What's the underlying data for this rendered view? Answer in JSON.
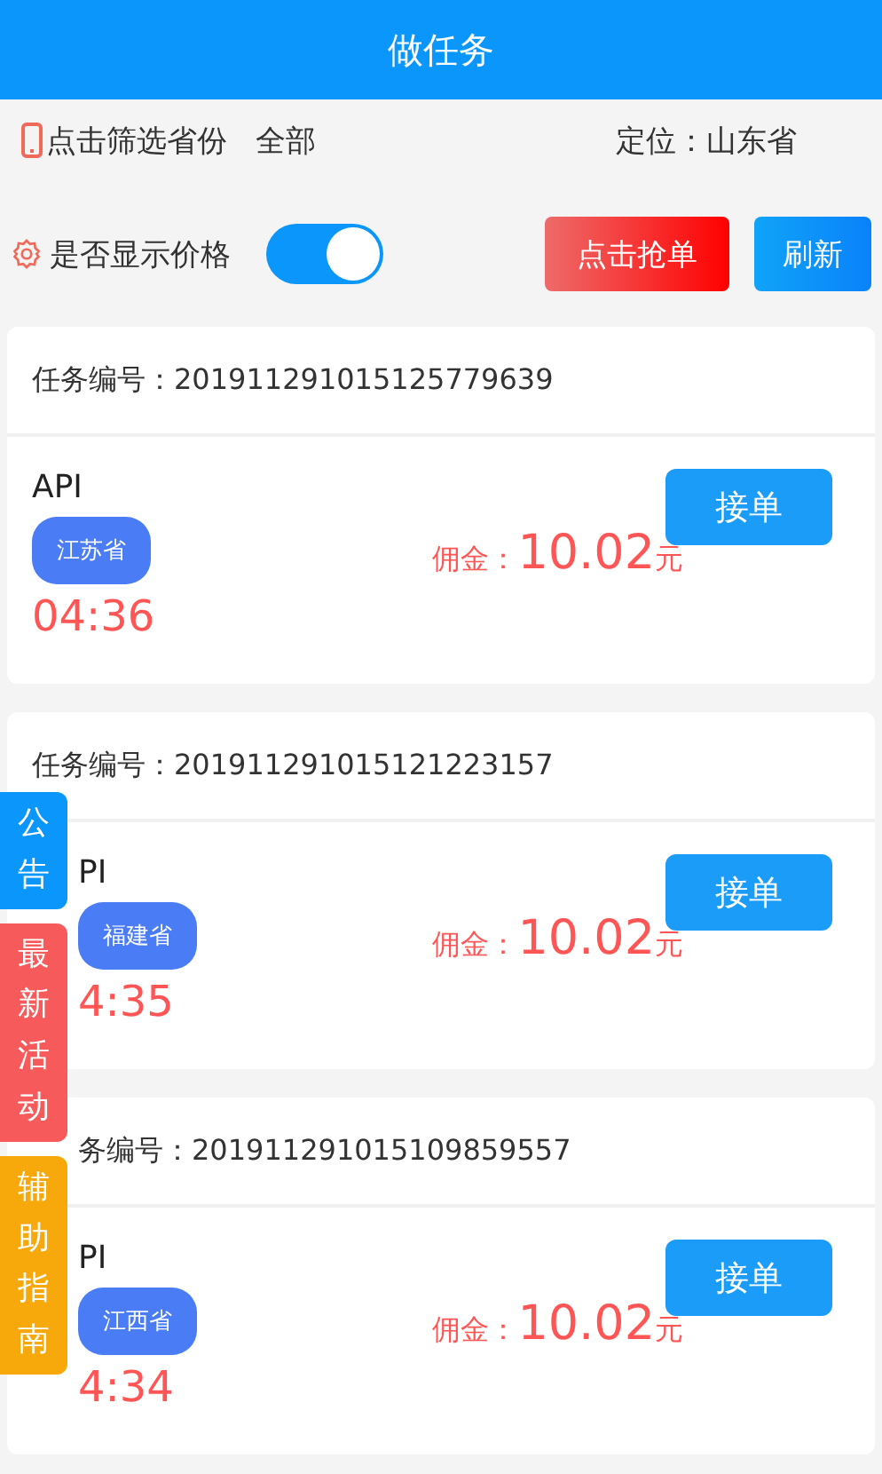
{
  "header": {
    "title": "做任务"
  },
  "filter": {
    "label": "点击筛选省份",
    "value": "全部",
    "location": "定位：山东省"
  },
  "price_toggle": {
    "label": "是否显示价格",
    "on": true
  },
  "buttons": [
    {
      "label": "点击抢单",
      "kind": "grab"
    },
    {
      "label": "刷新",
      "kind": "refresh"
    }
  ],
  "tasks": [
    {
      "number": "任务编号：201911291015125779639",
      "name": "API",
      "province": "江苏省",
      "commission_label": "佣金：",
      "amount": "10.02",
      "unit": "元",
      "time": "04:36",
      "action": "接单",
      "partly_hidden": false,
      "title_partly_hidden": false
    },
    {
      "number": "任务编号：201911291015121223157",
      "name": "PI",
      "province": "福建省",
      "commission_label": "佣金：",
      "amount": "10.02",
      "unit": "元",
      "time": "4:35",
      "action": "接单",
      "partly_hidden": true,
      "title_partly_hidden": false
    },
    {
      "number": "务编号：201911291015109859557",
      "name": "PI",
      "province": "江西省",
      "commission_label": "佣金：",
      "amount": "10.02",
      "unit": "元",
      "time": "4:34",
      "action": "接单",
      "partly_hidden": true,
      "title_partly_hidden": true
    }
  ],
  "side_tabs": [
    {
      "label": "公告",
      "color": "#0a96fa"
    },
    {
      "label": "最新活动",
      "color": "#f75a5a"
    },
    {
      "label": "辅助指南",
      "color": "#f7a80a"
    }
  ]
}
